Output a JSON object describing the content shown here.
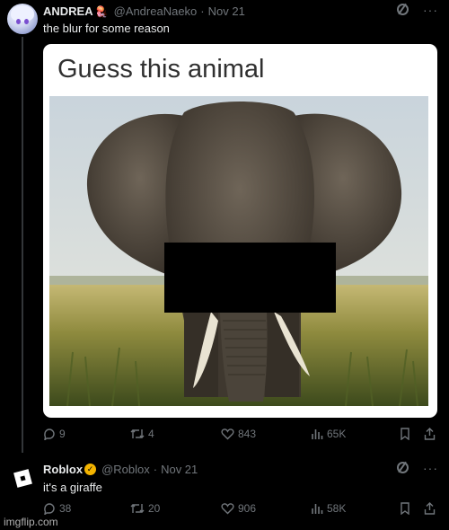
{
  "tweets": [
    {
      "author": "ANDREA",
      "handle": "@AndreaNaeko",
      "separator": "·",
      "date": "Nov 21",
      "text": "the blur for some reason",
      "media": {
        "title": "Guess this animal"
      },
      "stats": {
        "replies": "9",
        "reposts": "4",
        "likes": "843",
        "views": "65K"
      }
    },
    {
      "author": "Roblox",
      "handle": "@Roblox",
      "separator": "·",
      "date": "Nov 21",
      "text": "it's a giraffe",
      "stats": {
        "replies": "38",
        "reposts": "20",
        "likes": "906",
        "views": "58K"
      }
    }
  ],
  "more_label": "···",
  "watermark": "imgflip.com",
  "colors": {
    "background": "#000000",
    "muted": "#71767b",
    "text": "#e7e9ea",
    "verified": "#f4b400",
    "censor": "#000000"
  },
  "icons": [
    "reply-icon",
    "repost-icon",
    "like-icon",
    "views-icon",
    "bookmark-icon",
    "share-icon",
    "grok-icon",
    "more-icon"
  ]
}
